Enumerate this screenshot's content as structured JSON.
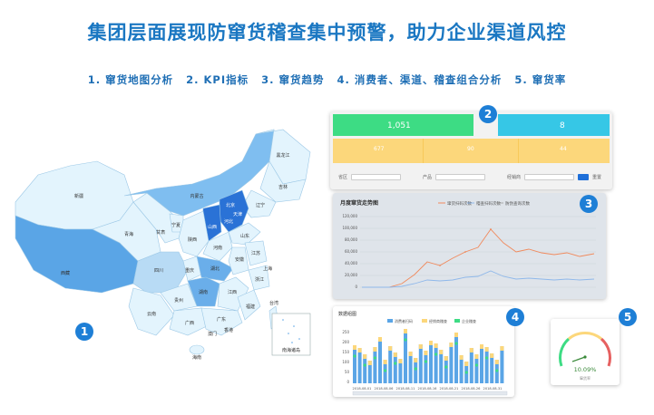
{
  "title": "集团层面展现防窜货稽查集中预警，助力企业渠道风控",
  "features": [
    "1. 窜货地图分析",
    "2. KPI指标",
    "3. 窜货趋势",
    "4. 消费者、渠道、稽查组合分析",
    "5. 窜货率"
  ],
  "badges": [
    "1",
    "2",
    "3",
    "4",
    "5"
  ],
  "map": {
    "provinces": [
      "新疆",
      "西藏",
      "青海",
      "甘肃",
      "宁夏",
      "内蒙古",
      "黑龙江",
      "吉林",
      "辽宁",
      "北京",
      "天津",
      "河北",
      "山西",
      "山东",
      "河南",
      "陕西",
      "四川",
      "重庆",
      "湖北",
      "安徽",
      "江苏",
      "上海",
      "浙江",
      "湖南",
      "江西",
      "福建",
      "贵州",
      "云南",
      "广西",
      "广东",
      "澳门",
      "香港",
      "台湾",
      "海南"
    ],
    "inset_label": "南海诸岛"
  },
  "kpi": {
    "card1_value": "1,051",
    "card2_value": "8",
    "row2_values": [
      "677",
      "90",
      "44"
    ],
    "filter_labels": [
      "省区",
      "产品",
      "经销商"
    ],
    "button_label": "查询",
    "reset_label": "重置"
  },
  "trend": {
    "title": "月度窜货走势图",
    "legend": [
      "窜货扫码次数",
      "稽查扫码次数",
      "防伪查询次数"
    ],
    "y_ticks": [
      "120,000",
      "100,000",
      "80,000",
      "60,000",
      "40,000",
      "20,000",
      "0"
    ]
  },
  "combo": {
    "title": "数据组图",
    "legend": [
      "消费者扫码",
      "经销商稽查",
      "企业稽查"
    ],
    "y_ticks": [
      "250",
      "200",
      "150",
      "100",
      "50",
      "0"
    ],
    "x_ticks": [
      "2018-08-01",
      "2018-08-06",
      "2018-08-11",
      "2018-08-16",
      "2018-08-21",
      "2018-08-26",
      "2018-08-31"
    ]
  },
  "gauge": {
    "value": "10.09%",
    "caption": "窜货率"
  },
  "colors": {
    "title": "#1a77c2",
    "badge": "#1e7fd6",
    "card_green": "#3ddc84",
    "card_cyan": "#36c7e6",
    "card_yellow": "#fcd77b",
    "line_orange": "#f08a5d",
    "line_blue": "#8fb8ea"
  }
}
